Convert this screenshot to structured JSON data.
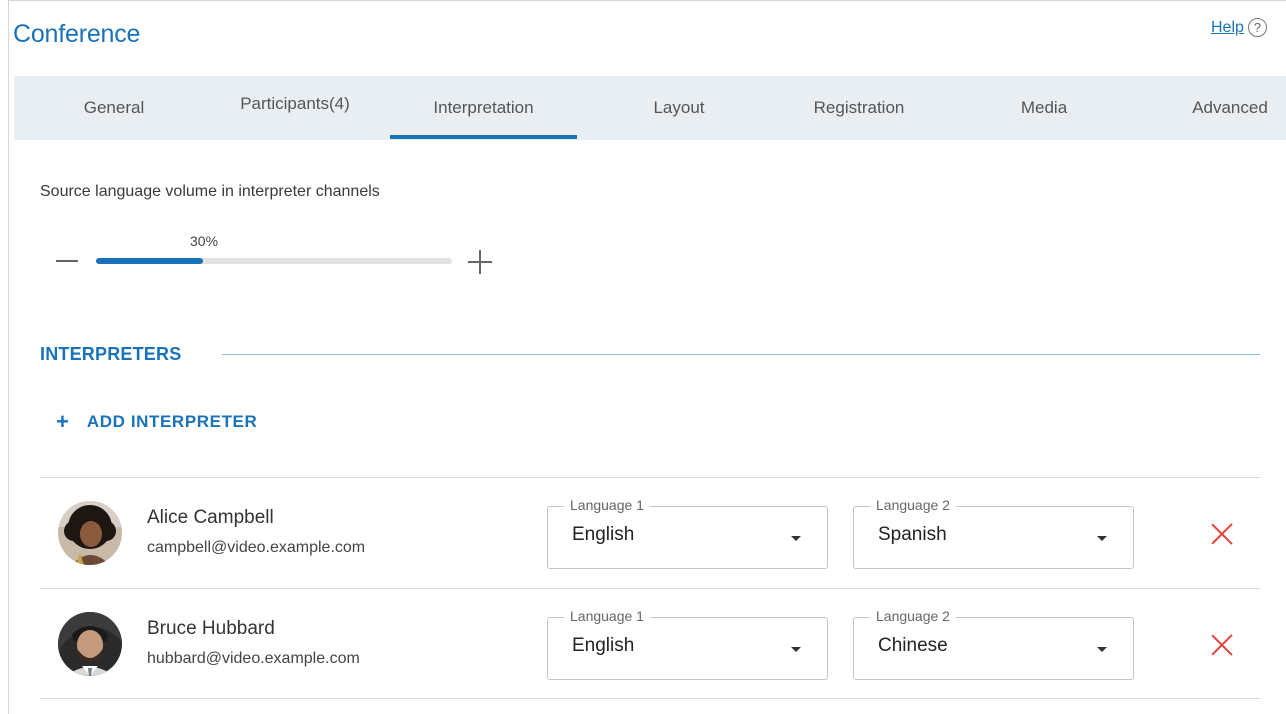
{
  "header": {
    "title": "Conference",
    "help_label": "Help",
    "help_icon": "?"
  },
  "tabs": [
    {
      "label": "General"
    },
    {
      "label": "Participants(4)"
    },
    {
      "label": "Interpretation",
      "active": true
    },
    {
      "label": "Layout"
    },
    {
      "label": "Registration"
    },
    {
      "label": "Media"
    },
    {
      "label": "Advanced"
    }
  ],
  "volume": {
    "label": "Source language volume in interpreter channels",
    "value_text": "30%",
    "value": 0.3
  },
  "interpreters": {
    "section_title": "INTERPRETERS",
    "add_label": "ADD INTERPRETER",
    "rows": [
      {
        "name": "Alice Campbell",
        "email": "campbell@video.example.com",
        "lang1_label": "Language 1",
        "lang1_value": "English",
        "lang2_label": "Language 2",
        "lang2_value": "Spanish"
      },
      {
        "name": "Bruce Hubbard",
        "email": "hubbard@video.example.com",
        "lang1_label": "Language 1",
        "lang1_value": "English",
        "lang2_label": "Language 2",
        "lang2_value": "Chinese"
      }
    ]
  },
  "colors": {
    "accent": "#1a73b8",
    "tab_bar": "#e9eef3",
    "delete": "#e2453b"
  }
}
